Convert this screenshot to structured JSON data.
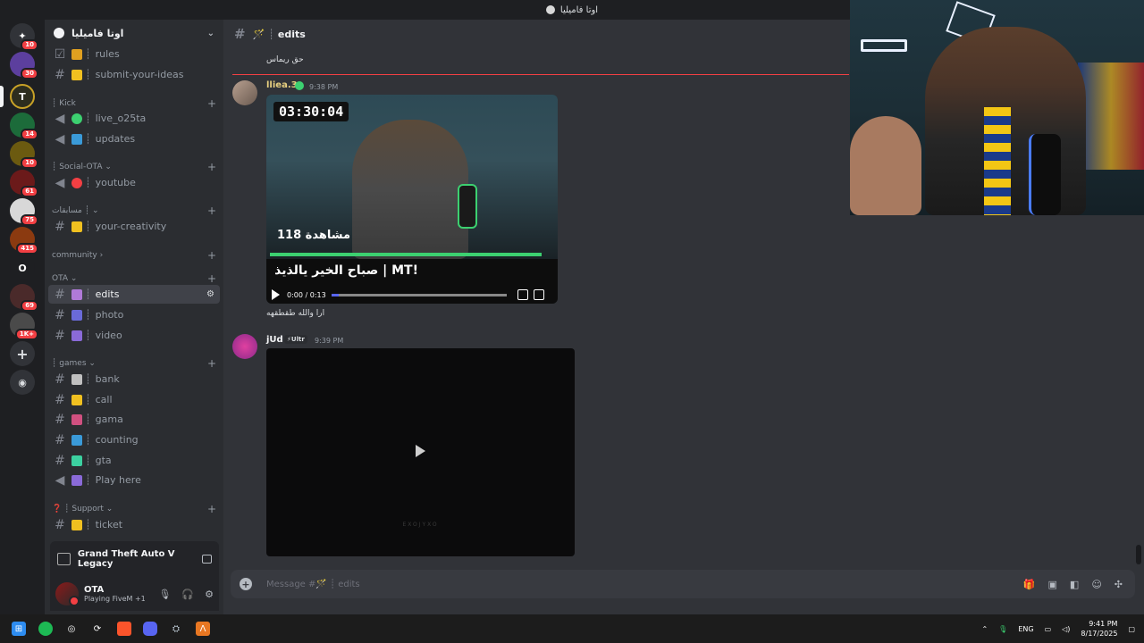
{
  "window": {
    "title": "اوتا فاميليا"
  },
  "servers": [
    {
      "name": "discord-home",
      "badge": "10",
      "color": "#313338",
      "glyph": "✦"
    },
    {
      "name": "server-2",
      "badge": "30",
      "color": "#5c3f9e",
      "glyph": ""
    },
    {
      "name": "server-3",
      "badge": "",
      "color": "#3a3a2a",
      "glyph": "T"
    },
    {
      "name": "server-4",
      "badge": "14",
      "color": "#1c6b3a",
      "glyph": ""
    },
    {
      "name": "server-5",
      "badge": "10",
      "color": "#6b5a10",
      "glyph": ""
    },
    {
      "name": "server-6",
      "badge": "61",
      "color": "#6b1a1a",
      "glyph": ""
    },
    {
      "name": "server-7",
      "badge": "75",
      "color": "#3a3a3a",
      "glyph": ""
    },
    {
      "name": "server-8",
      "badge": "415",
      "color": "#8b3a10",
      "glyph": ""
    },
    {
      "name": "server-9",
      "badge": "",
      "color": "#1e1f22",
      "glyph": "O"
    },
    {
      "name": "server-10",
      "badge": "69",
      "color": "#4a2a2a",
      "glyph": ""
    },
    {
      "name": "server-11",
      "badge": "1K+",
      "color": "#4a4a4a",
      "glyph": ""
    }
  ],
  "guild": {
    "name": "اوتا فاميليا"
  },
  "channels": {
    "rules": "rules",
    "submit": "submit-your-ideas",
    "cat_kick": "Kick",
    "live": "live_o25ta",
    "updates": "updates",
    "cat_social": "Social-OTA",
    "youtube": "youtube",
    "cat_contests": "مسابقات",
    "creativity": "your-creativity",
    "cat_community": "community",
    "cat_ota": "OTA",
    "edits": "edits",
    "photo": "photo",
    "video": "video",
    "cat_games": "games",
    "bank": "bank",
    "call": "call",
    "gama": "gama",
    "counting": "counting",
    "gta": "gta",
    "playhere": "Play here",
    "cat_support": "Support",
    "ticket": "ticket"
  },
  "activity": {
    "game": "Grand Theft Auto V Legacy"
  },
  "user": {
    "name": "OTA",
    "status": "Playing FiveM",
    "extra": "+1"
  },
  "header": {
    "channel": "edits"
  },
  "messages": {
    "top_text": "حق ريماس",
    "m1_user": "lliea.3",
    "m1_time": "9:38 PM",
    "m1_timer": "03:30:04",
    "m1_views": "118 مشاهدة",
    "m1_caption": "صباح الخير يالذيذ | MT!",
    "m1_player_time": "0:00 / 0:13",
    "m1_text": "ارا والله طقطقهه",
    "m2_user": "jUd",
    "m2_tag": "⚡Ultr",
    "m2_time": "9:39 PM",
    "m2_watermark": "EXOJYXO"
  },
  "composer": {
    "placeholder": "Message #🪄 ┊ edits"
  },
  "tray": {
    "lang": "ENG",
    "time": "9:41 PM",
    "date": "8/17/2025"
  },
  "colors": {
    "accent": "#5865f2",
    "red": "#f23f43",
    "green": "#3cd070"
  }
}
